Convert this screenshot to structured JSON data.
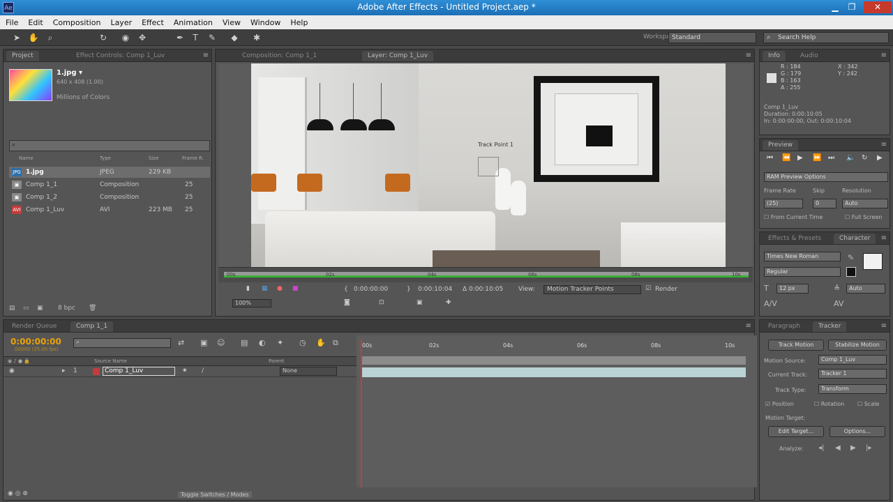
{
  "window": {
    "title": "Adobe After Effects - Untitled Project.aep *"
  },
  "menu": [
    "File",
    "Edit",
    "Composition",
    "Layer",
    "Effect",
    "Animation",
    "View",
    "Window",
    "Help"
  ],
  "toolbar": {
    "workspace_label": "Workspace:",
    "workspace_value": "Standard",
    "search_help": "Search Help"
  },
  "project": {
    "tabs": [
      "Project",
      "Effect Controls: Comp 1_Luv"
    ],
    "file_name": "1.jpg ▾",
    "file_meta": "640 x 408 (1.00)",
    "file_colors": "Millions of Colors",
    "columns": [
      "Name",
      "Type",
      "Size",
      "Frame R."
    ],
    "items": [
      {
        "name": "1.jpg",
        "type": "JPEG",
        "size": "229 KB",
        "rate": ""
      },
      {
        "name": "Comp 1_1",
        "type": "Composition",
        "size": "",
        "rate": "25"
      },
      {
        "name": "Comp 1_2",
        "type": "Composition",
        "size": "",
        "rate": "25"
      },
      {
        "name": "Comp 1_Luv",
        "type": "AVI",
        "size": "223 MB",
        "rate": "25"
      }
    ],
    "footer_bpc": "8 bpc"
  },
  "viewer": {
    "tabs": [
      "Composition: Comp 1_1",
      "Layer: Comp 1_Luv"
    ],
    "track_point_label": "Track Point 1",
    "ruler": [
      "00s",
      "02s",
      "04s",
      "06s",
      "08s",
      "10s"
    ],
    "zoom": "100%",
    "time1": "0:00:00:00",
    "time2": "0:00:10:04",
    "delta": "Δ 0:00:10:05",
    "view_label": "View:",
    "view_value": "Motion Tracker Points",
    "render_label": "Render"
  },
  "info": {
    "tabs": [
      "Info",
      "Audio"
    ],
    "r": "R : 184",
    "g": "G : 179",
    "b": "B : 163",
    "a": "A : 255",
    "x": "X : 342",
    "y": "Y : 242",
    "comp_name": "Comp 1_Luv",
    "duration": "Duration: 0:00:10:05",
    "in_out": "In: 0:00:00:00, Out: 0:00:10:04"
  },
  "preview": {
    "tab": "Preview",
    "ram_options": "RAM Preview Options",
    "frame_rate_label": "Frame Rate",
    "skip_label": "Skip",
    "resolution_label": "Resolution",
    "frame_rate_value": "(25)",
    "skip_value": "0",
    "resolution_value": "Auto",
    "from_current": "From Current Time",
    "full_screen": "Full Screen"
  },
  "character": {
    "tabs": [
      "Effects & Presets",
      "Character"
    ],
    "font": "Times New Roman",
    "style": "Regular",
    "size": "12 px",
    "leading": "Auto"
  },
  "timeline": {
    "tabs": [
      "Render Queue",
      "Comp 1_1"
    ],
    "time": "0:00:00:00",
    "fps": "00000 (25.00 fps)",
    "headers": [
      "Source Name",
      "Parent"
    ],
    "layer_index": "1",
    "layer_name": "Comp 1_Luv",
    "parent": "None",
    "ruler": [
      "00s",
      "02s",
      "04s",
      "06s",
      "08s",
      "10s"
    ],
    "toggle": "Toggle Switches / Modes"
  },
  "tracker": {
    "tabs": [
      "Paragraph",
      "Tracker"
    ],
    "track_motion": "Track Motion",
    "stabilize_motion": "Stabilize Motion",
    "motion_source_label": "Motion Source:",
    "motion_source_value": "Comp 1_Luv",
    "current_track_label": "Current Track:",
    "current_track_value": "Tracker 1",
    "track_type_label": "Track Type:",
    "track_type_value": "Transform",
    "position": "Position",
    "rotation": "Rotation",
    "scale": "Scale",
    "motion_target": "Motion Target:",
    "edit_target": "Edit Target...",
    "options": "Options...",
    "analyze": "Analyze:"
  }
}
